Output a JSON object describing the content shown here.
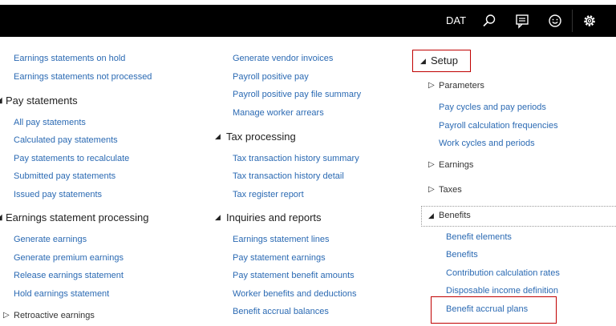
{
  "topbar": {
    "company": "DAT",
    "icons": [
      "search-icon",
      "comment-icon",
      "smiley-icon",
      "gear-icon"
    ]
  },
  "col1": {
    "links_top": [
      "Earnings statements on hold",
      "Earnings statements not processed"
    ],
    "pay_statements": {
      "title": "Pay statements",
      "links": [
        "All pay statements",
        "Calculated pay statements",
        "Pay statements to recalculate",
        "Submitted pay statements",
        "Issued pay statements"
      ]
    },
    "earnings_processing": {
      "title": "Earnings statement processing",
      "links": [
        "Generate earnings",
        "Generate premium earnings",
        "Release earnings statement",
        "Hold earnings statement"
      ]
    },
    "retroactive": "Retroactive earnings"
  },
  "col2": {
    "links_top": [
      "Generate vendor invoices",
      "Payroll positive pay",
      "Payroll positive pay file summary",
      "Manage worker arrears"
    ],
    "tax_processing": {
      "title": "Tax processing",
      "links": [
        "Tax transaction history summary",
        "Tax transaction history detail",
        "Tax register report"
      ]
    },
    "inquiries": {
      "title": "Inquiries and reports",
      "links": [
        "Earnings statement lines",
        "Pay statement earnings",
        "Pay statement benefit amounts",
        "Worker benefits and deductions",
        "Benefit accrual balances"
      ]
    }
  },
  "col3": {
    "setup": "Setup",
    "parameters": "Parameters",
    "param_links": [
      "Pay cycles and pay periods",
      "Payroll calculation frequencies",
      "Work cycles and periods"
    ],
    "earnings": "Earnings",
    "taxes": "Taxes",
    "benefits": "Benefits",
    "benefit_links": [
      "Benefit elements",
      "Benefits",
      "Contribution calculation rates",
      "Disposable income definition",
      "Benefit accrual plans"
    ]
  }
}
